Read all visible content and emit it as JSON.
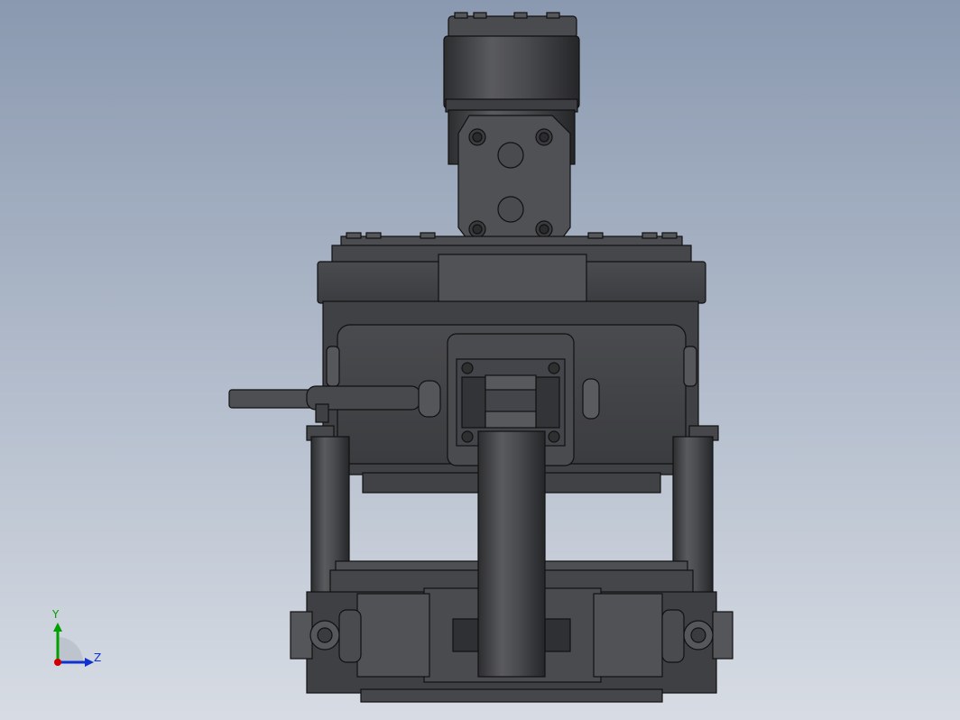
{
  "colors": {
    "background_top": "#8a99b0",
    "background_bottom": "#d7dce4",
    "part_dark": "#3a3b3d",
    "part_mid": "#505155",
    "part_light": "#6a6b6f",
    "edge": "#111111",
    "axis_x": "#d10000",
    "axis_y": "#00a000",
    "axis_z": "#1030d0"
  },
  "view": {
    "model_name": "",
    "orientation_triad": {
      "y_label": "Y",
      "z_label": "Z",
      "icon": "coordinate-triad-icon"
    }
  }
}
